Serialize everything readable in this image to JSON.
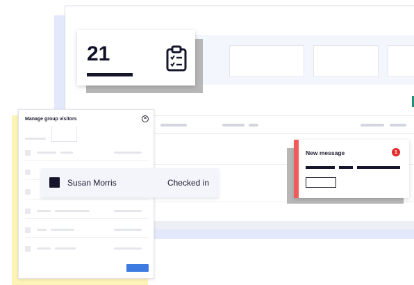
{
  "stat_card": {
    "value": "21",
    "icon": "clipboard-checklist-icon"
  },
  "dialog": {
    "title": "Manage group visitors",
    "close_icon": "close-circle-icon",
    "rows": 7
  },
  "visitor_row": {
    "name": "Susan Morris",
    "status": "Checked in"
  },
  "notification": {
    "title": "New message",
    "badge_count": "1"
  },
  "colors": {
    "accent_blue": "#3d7be0",
    "notification_red": "#ef5a5a",
    "badge_red": "#e22b2b",
    "dialog_shadow_yellow": "#fcf4b8",
    "dark_ink": "#15152b",
    "background_blue": "#e3e8fb"
  }
}
